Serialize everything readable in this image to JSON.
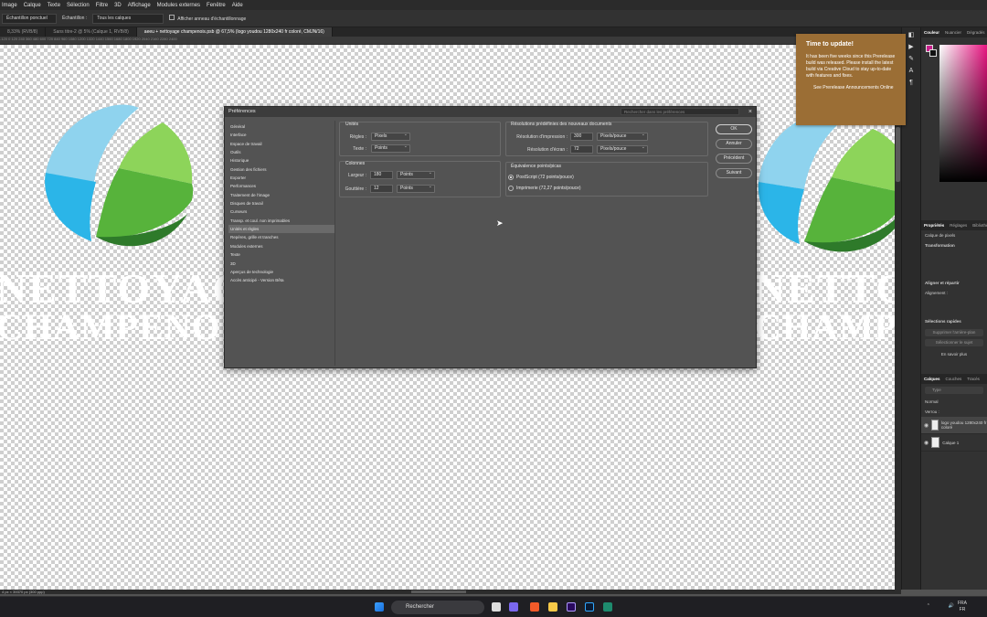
{
  "menubar": [
    "Image",
    "Calque",
    "Texte",
    "Sélection",
    "Filtre",
    "3D",
    "Affichage",
    "Modules externes",
    "Fenêtre",
    "Aide"
  ],
  "options": {
    "sample_tool": "Échantillon ponctuel",
    "sample_label": "Échantillon :",
    "sample_value": "Tous les calques",
    "ring_label": "Afficher anneau d'échantillonnage"
  },
  "doc_tabs": [
    {
      "label": "8,33% (RVB/8)"
    },
    {
      "label": "Sans titre-2 @ 5% (Calque 1, RVB/8)"
    },
    {
      "label": "aeeu + nettoyage champenois.psb @ 67,5% (logo youdou 1280x240 fr coloré, CMJN/16)"
    }
  ],
  "ruler_ticks": "-120   0   120   240   360   480   600   720   840   960   1080   1200   1320   1440   1560   1680   1800   1920   2040   2160   2280   2400",
  "canvas_text": {
    "line1_left": "NETTOYAG",
    "line2_left": "CHAMPENOI",
    "line1_right": "NETTOYA",
    "line2_right": "CHAMPEN"
  },
  "status": "4 px × 39370 px (300 ppp)",
  "notification": {
    "title": "Time to update!",
    "body": "It has been five weeks since this Prerelease build was released. Please install the latest build via Creative Cloud to stay up-to-date with features and fixes.",
    "link": "See Prerelease Announcements Online"
  },
  "dialog": {
    "title": "Préférences",
    "search_placeholder": "Rechercher dans les préférences",
    "nav": [
      "Général",
      "Interface",
      "Espace de travail",
      "Outils",
      "Historique",
      "Gestion des fichiers",
      "Exporter",
      "Performances",
      "Traitement de l'image",
      "Disques de travail",
      "Curseurs",
      "Transp. et coul. non imprimables",
      "Unités et règles",
      "Repères, grille et tranches",
      "Modules externes",
      "Texte",
      "3D",
      "Aperçus de technologie",
      "Accès anticipé - Version Bêta"
    ],
    "selected_nav_index": 12,
    "units": {
      "title": "Unités",
      "rulers_label": "Règles :",
      "rulers_value": "Pixels",
      "type_label": "Texte :",
      "type_value": "Points"
    },
    "columns": {
      "title": "Colonnes",
      "width_label": "Largeur :",
      "width_value": "180",
      "width_unit": "Points",
      "gutter_label": "Gouttière :",
      "gutter_value": "12",
      "gutter_unit": "Points"
    },
    "resolutions": {
      "title": "Résolutions prédéfinies des nouveaux documents",
      "print_label": "Résolution d'impression :",
      "print_value": "300",
      "print_unit": "Pixels/pouce",
      "screen_label": "Résolution d'écran :",
      "screen_value": "72",
      "screen_unit": "Pixels/pouce"
    },
    "points": {
      "title": "Équivalence points/picas",
      "opt1": "PostScript (72 points/pouce)",
      "opt2": "Imprimerie (72,27 points/pouce)",
      "selected": 0
    },
    "buttons": {
      "ok": "OK",
      "cancel": "Annuler",
      "prev": "Précédent",
      "next": "Suivant"
    }
  },
  "right_panel": {
    "color_tabs": [
      "Couleur",
      "Nuancier",
      "Dégradés"
    ],
    "props_tabs": [
      "Propriétés",
      "Réglages",
      "Bibliothèques"
    ],
    "layer_type": "Calque de pixels",
    "transform": "Transformation",
    "align": "Aligner et répartir",
    "align_sub": "Alignement :",
    "quick_actions": "Sélections rapides",
    "qa_btn1": "Supprimer l'arrière-plan",
    "qa_btn2": "Sélectionner le sujet",
    "learn_more": "En savoir plus",
    "layers_tabs": [
      "Calques",
      "Couches",
      "Tracés"
    ],
    "kind_placeholder": "Type",
    "blend": "Normal",
    "lock": "Verrou :",
    "layers": [
      {
        "name": "logo youdou 1280x240 fr coloré"
      },
      {
        "name": "Calque 1"
      }
    ]
  },
  "taskbar": {
    "search": "Rechercher",
    "lang1": "FRA",
    "lang2": "FR"
  },
  "colors": {
    "notification": "#9b6e35",
    "leaf_light_blue": "#8fd3ee",
    "leaf_blue": "#2bb5e8",
    "leaf_light_green": "#8dd45a",
    "leaf_green": "#57b33b",
    "leaf_dark_green": "#2e7a2a"
  }
}
